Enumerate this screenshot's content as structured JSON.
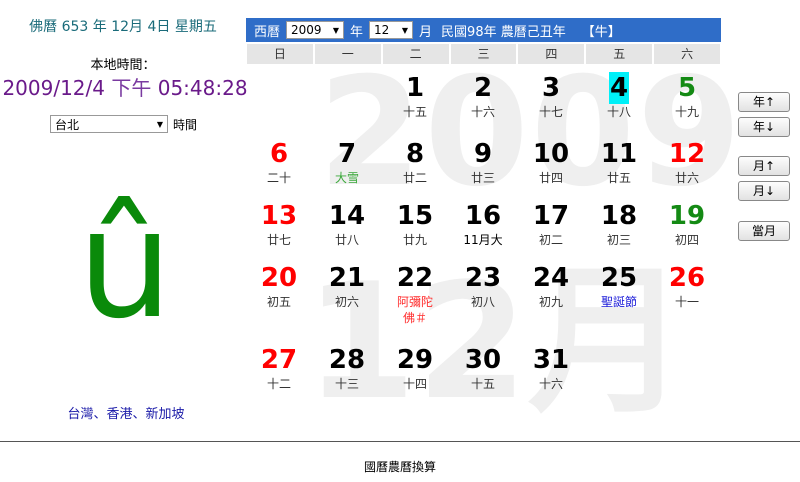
{
  "left": {
    "buddhist_date": "佛曆 653 年 12月 4日 星期五",
    "local_label": "本地時間：",
    "local_date": "2009/12/4",
    "local_ampm": "下午",
    "local_clock": "05:48:28",
    "city_value": "台北",
    "time_label": "時間",
    "big_glyph": "û",
    "regions": "台灣、香港、新加坡"
  },
  "header": {
    "gregorian_label": "西曆",
    "year_value": "2009",
    "year_label": "年",
    "month_value": "12",
    "month_label": "月",
    "lunar_info": "民國98年 農曆己丑年",
    "zodiac": "【牛】"
  },
  "weekdays": [
    "日",
    "一",
    "二",
    "三",
    "四",
    "五",
    "六"
  ],
  "watermark": {
    "year": "2009",
    "month": "12月"
  },
  "colors": {
    "sunday": "#ff0000",
    "saturday": "#148a14",
    "weekday": "#000000",
    "holiday": "#ff2a2a",
    "festival": "#1a1ad8",
    "solar_term": "#3aa83a",
    "lunar_default": "#333333",
    "today_highlight": "#00f0f8"
  },
  "days": [
    {
      "day": "1",
      "lunar": "十五",
      "col": 2,
      "row": 0
    },
    {
      "day": "2",
      "lunar": "十六",
      "col": 3,
      "row": 0
    },
    {
      "day": "3",
      "lunar": "十七",
      "col": 4,
      "row": 0
    },
    {
      "day": "4",
      "lunar": "十八",
      "col": 5,
      "row": 0,
      "today": true
    },
    {
      "day": "5",
      "lunar": "十九",
      "col": 6,
      "row": 0
    },
    {
      "day": "6",
      "lunar": "二十",
      "col": 0,
      "row": 1
    },
    {
      "day": "7",
      "lunar": "大雪",
      "col": 1,
      "row": 1,
      "lunar_color": "solar_term"
    },
    {
      "day": "8",
      "lunar": "廿二",
      "col": 2,
      "row": 1
    },
    {
      "day": "9",
      "lunar": "廿三",
      "col": 3,
      "row": 1
    },
    {
      "day": "10",
      "lunar": "廿四",
      "col": 4,
      "row": 1
    },
    {
      "day": "11",
      "lunar": "廿五",
      "col": 5,
      "row": 1
    },
    {
      "day": "12",
      "lunar": "廿六",
      "col": 6,
      "row": 1,
      "num_color": "sunday"
    },
    {
      "day": "13",
      "lunar": "廿七",
      "col": 0,
      "row": 2
    },
    {
      "day": "14",
      "lunar": "廿八",
      "col": 1,
      "row": 2
    },
    {
      "day": "15",
      "lunar": "廿九",
      "col": 2,
      "row": 2
    },
    {
      "day": "16",
      "lunar": "11月大",
      "col": 3,
      "row": 2,
      "lunar_color": "weekday"
    },
    {
      "day": "17",
      "lunar": "初二",
      "col": 4,
      "row": 2
    },
    {
      "day": "18",
      "lunar": "初三",
      "col": 5,
      "row": 2
    },
    {
      "day": "19",
      "lunar": "初四",
      "col": 6,
      "row": 2
    },
    {
      "day": "20",
      "lunar": "初五",
      "col": 0,
      "row": 3
    },
    {
      "day": "21",
      "lunar": "初六",
      "col": 1,
      "row": 3
    },
    {
      "day": "22",
      "lunar": "阿彌陀",
      "lunar2": "佛＃",
      "col": 2,
      "row": 3,
      "lunar_color": "holiday"
    },
    {
      "day": "23",
      "lunar": "初八",
      "col": 3,
      "row": 3
    },
    {
      "day": "24",
      "lunar": "初九",
      "col": 4,
      "row": 3
    },
    {
      "day": "25",
      "lunar": "聖誕節",
      "col": 5,
      "row": 3,
      "lunar_color": "festival"
    },
    {
      "day": "26",
      "lunar": "十一",
      "col": 6,
      "row": 3,
      "num_color": "sunday"
    },
    {
      "day": "27",
      "lunar": "十二",
      "col": 0,
      "row": 4
    },
    {
      "day": "28",
      "lunar": "十三",
      "col": 1,
      "row": 4
    },
    {
      "day": "29",
      "lunar": "十四",
      "col": 2,
      "row": 4
    },
    {
      "day": "30",
      "lunar": "十五",
      "col": 3,
      "row": 4
    },
    {
      "day": "31",
      "lunar": "十六",
      "col": 4,
      "row": 4
    }
  ],
  "buttons": {
    "year_up": "年↑",
    "year_down": "年↓",
    "month_up": "月↑",
    "month_down": "月↓",
    "current": "當月"
  },
  "footer": "國曆農曆換算"
}
